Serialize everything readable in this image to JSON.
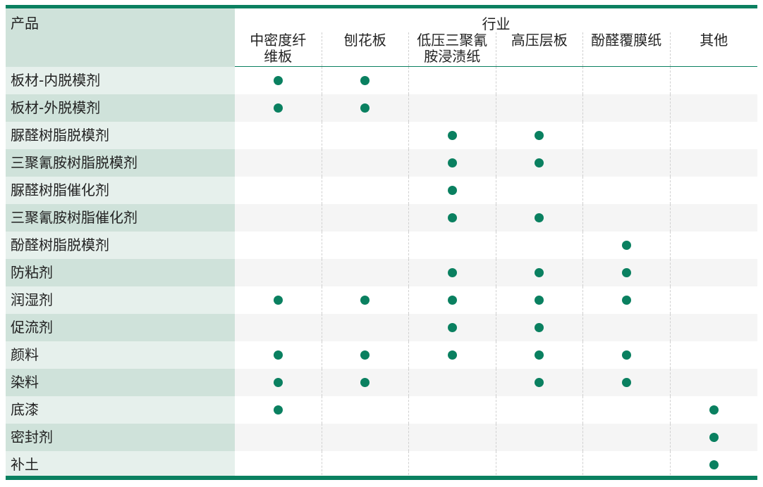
{
  "header": {
    "product_label": "产品",
    "industry_label": "行业",
    "industries": [
      "中密度纤\n维板",
      "刨花板",
      "低压三聚氰\n胺浸渍纸",
      "高压层板",
      "酚醛覆膜纸",
      "其他"
    ]
  },
  "rows": [
    {
      "name": "板材-内脱模剂",
      "marks": [
        1,
        1,
        0,
        0,
        0,
        0
      ]
    },
    {
      "name": "板材-外脱模剂",
      "marks": [
        1,
        1,
        0,
        0,
        0,
        0
      ]
    },
    {
      "name": "脲醛树脂脱模剂",
      "marks": [
        0,
        0,
        1,
        1,
        0,
        0
      ]
    },
    {
      "name": "三聚氰胺树脂脱模剂",
      "marks": [
        0,
        0,
        1,
        1,
        0,
        0
      ]
    },
    {
      "name": "脲醛树脂催化剂",
      "marks": [
        0,
        0,
        1,
        0,
        0,
        0
      ]
    },
    {
      "name": "三聚氰胺树脂催化剂",
      "marks": [
        0,
        0,
        1,
        1,
        0,
        0
      ]
    },
    {
      "name": "酚醛树脂脱模剂",
      "marks": [
        0,
        0,
        0,
        0,
        1,
        0
      ]
    },
    {
      "name": "防粘剂",
      "marks": [
        0,
        0,
        1,
        1,
        1,
        0
      ]
    },
    {
      "name": "润湿剂",
      "marks": [
        1,
        1,
        1,
        1,
        1,
        0
      ]
    },
    {
      "name": "促流剂",
      "marks": [
        0,
        0,
        1,
        1,
        0,
        0
      ]
    },
    {
      "name": "颜料",
      "marks": [
        1,
        1,
        1,
        1,
        1,
        0
      ]
    },
    {
      "name": "染料",
      "marks": [
        1,
        1,
        0,
        1,
        1,
        0
      ]
    },
    {
      "name": "底漆",
      "marks": [
        1,
        0,
        0,
        0,
        0,
        1
      ]
    },
    {
      "name": "密封剂",
      "marks": [
        0,
        0,
        0,
        0,
        0,
        1
      ]
    },
    {
      "name": "补土",
      "marks": [
        0,
        0,
        0,
        0,
        0,
        1
      ]
    }
  ],
  "colors": {
    "accent": "#0a8060"
  }
}
